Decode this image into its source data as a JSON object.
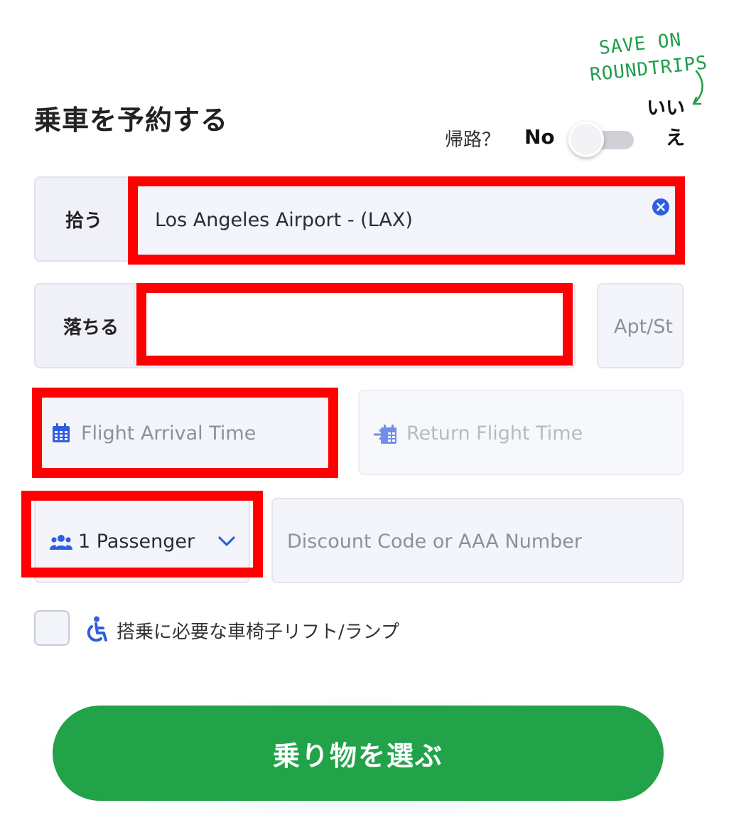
{
  "header": {
    "title": "乗車を予約する",
    "promo_line1": "SAVE ON",
    "promo_line2": "ROUNDTRIPS",
    "roundtrip_label": "帰路？",
    "toggle_off_label": "No",
    "toggle_on_label": "いいえ"
  },
  "pickup": {
    "label": "拾う",
    "value": "Los Angeles Airport - (LAX)"
  },
  "dropoff": {
    "label": "落ちる",
    "value": "",
    "apt_placeholder": "Apt/St"
  },
  "flight": {
    "arrival_placeholder": "Flight Arrival Time",
    "return_placeholder": "Return Flight Time"
  },
  "passengers": {
    "selected": "1 Passenger"
  },
  "discount": {
    "placeholder": "Discount Code or AAA Number"
  },
  "wheelchair": {
    "label": "搭乗に必要な車椅子リフト/ランプ",
    "checked": false
  },
  "submit": {
    "label": "乗り物を選ぶ"
  },
  "colors": {
    "accent_green": "#22a34a",
    "highlight_red": "#ff0000",
    "icon_blue": "#2f5fe0"
  }
}
